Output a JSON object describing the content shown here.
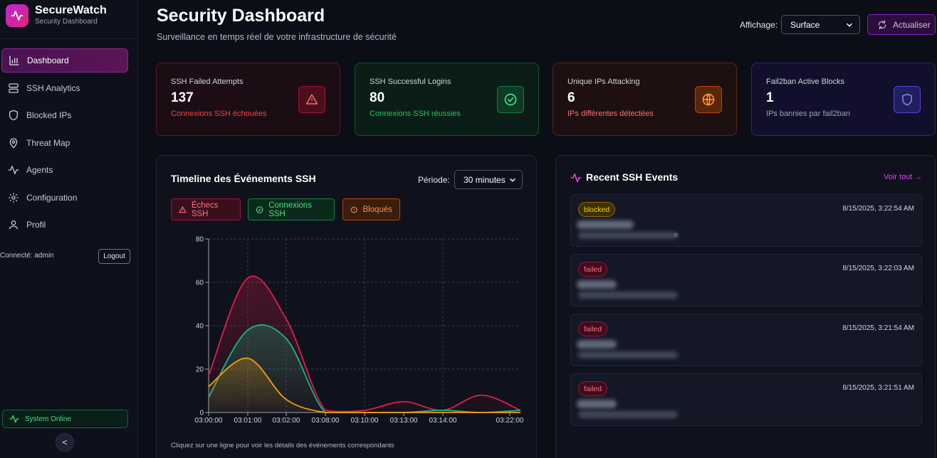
{
  "brand": {
    "title": "SecureWatch",
    "subtitle": "Security Dashboard"
  },
  "nav": [
    {
      "label": "Dashboard",
      "icon": "bar-chart-icon",
      "active": true
    },
    {
      "label": "SSH Analytics",
      "icon": "server-icon"
    },
    {
      "label": "Blocked IPs",
      "icon": "shield-icon"
    },
    {
      "label": "Threat Map",
      "icon": "map-pin-icon"
    },
    {
      "label": "Agents",
      "icon": "activity-icon"
    },
    {
      "label": "Configuration",
      "icon": "gear-icon"
    },
    {
      "label": "Profil",
      "icon": "user-icon"
    }
  ],
  "session": {
    "connected": "Connecté: admin",
    "logout": "Logout"
  },
  "status": {
    "label": "System Online",
    "color": "#4ade80"
  },
  "collapse_label": "<",
  "header": {
    "title": "Security Dashboard",
    "subtitle": "Surveillance en temps réel de votre infrastructure de sécurité",
    "view_label": "Affichage:",
    "view_value": "Surface",
    "refresh": "Actualiser"
  },
  "kpis": [
    {
      "label": "SSH Failed Attempts",
      "value": "137",
      "desc": "Connexions SSH échouées",
      "icon": "alert-triangle-icon",
      "color": "#ef4444"
    },
    {
      "label": "SSH Successful Logins",
      "value": "80",
      "desc": "Connexions SSH réussies",
      "icon": "check-circle-icon",
      "color": "#22c55e"
    },
    {
      "label": "Unique IPs Attacking",
      "value": "6",
      "desc": "IPs différentes détectées",
      "icon": "globe-icon",
      "color": "#f97316"
    },
    {
      "label": "Fail2ban Active Blocks",
      "value": "1",
      "desc": "IPs bannies par fail2ban",
      "icon": "shield-icon",
      "color": "#6366f1"
    }
  ],
  "timeline": {
    "title": "Timeline des Événements SSH",
    "period_label": "Période:",
    "period_value": "30 minutes",
    "legend": {
      "failed": "Échecs SSH",
      "success": "Connexions SSH",
      "blocked": "Bloqués"
    },
    "note": "Cliquez sur une ligne pour voir les détails des événements correspondants"
  },
  "chart_data": {
    "type": "area",
    "categories": [
      "03:00:00",
      "03:01:00",
      "03:02:00",
      "03:08:00",
      "03:10:00",
      "03:13:00",
      "03:14:00",
      "03:22:00"
    ],
    "series": [
      {
        "name": "Échecs SSH",
        "color": "#e11d48",
        "values": [
          17,
          62,
          43,
          1,
          1,
          5,
          1,
          8,
          1
        ]
      },
      {
        "name": "Connexions SSH",
        "color": "#10b981",
        "values": [
          7,
          38,
          34,
          0,
          0,
          0,
          1,
          0,
          1
        ]
      },
      {
        "name": "Bloqués",
        "color": "#f59e0b",
        "values": [
          12,
          25,
          6,
          0,
          0,
          0,
          0,
          0,
          0
        ]
      }
    ],
    "yticks": [
      0,
      20,
      40,
      60,
      80
    ],
    "ylim": [
      0,
      80
    ],
    "grid": true
  },
  "recent": {
    "title": "Recent SSH Events",
    "see_all": "Voir tout →",
    "events": [
      {
        "status": "blocked",
        "time": "8/15/2025, 3:22:54 AM",
        "tail": "n"
      },
      {
        "status": "failed",
        "time": "8/15/2025, 3:22:03 AM",
        "tail": ""
      },
      {
        "status": "failed",
        "time": "8/15/2025, 3:21:54 AM",
        "tail": ""
      },
      {
        "status": "failed",
        "time": "8/15/2025, 3:21:51 AM",
        "tail": ""
      }
    ]
  }
}
